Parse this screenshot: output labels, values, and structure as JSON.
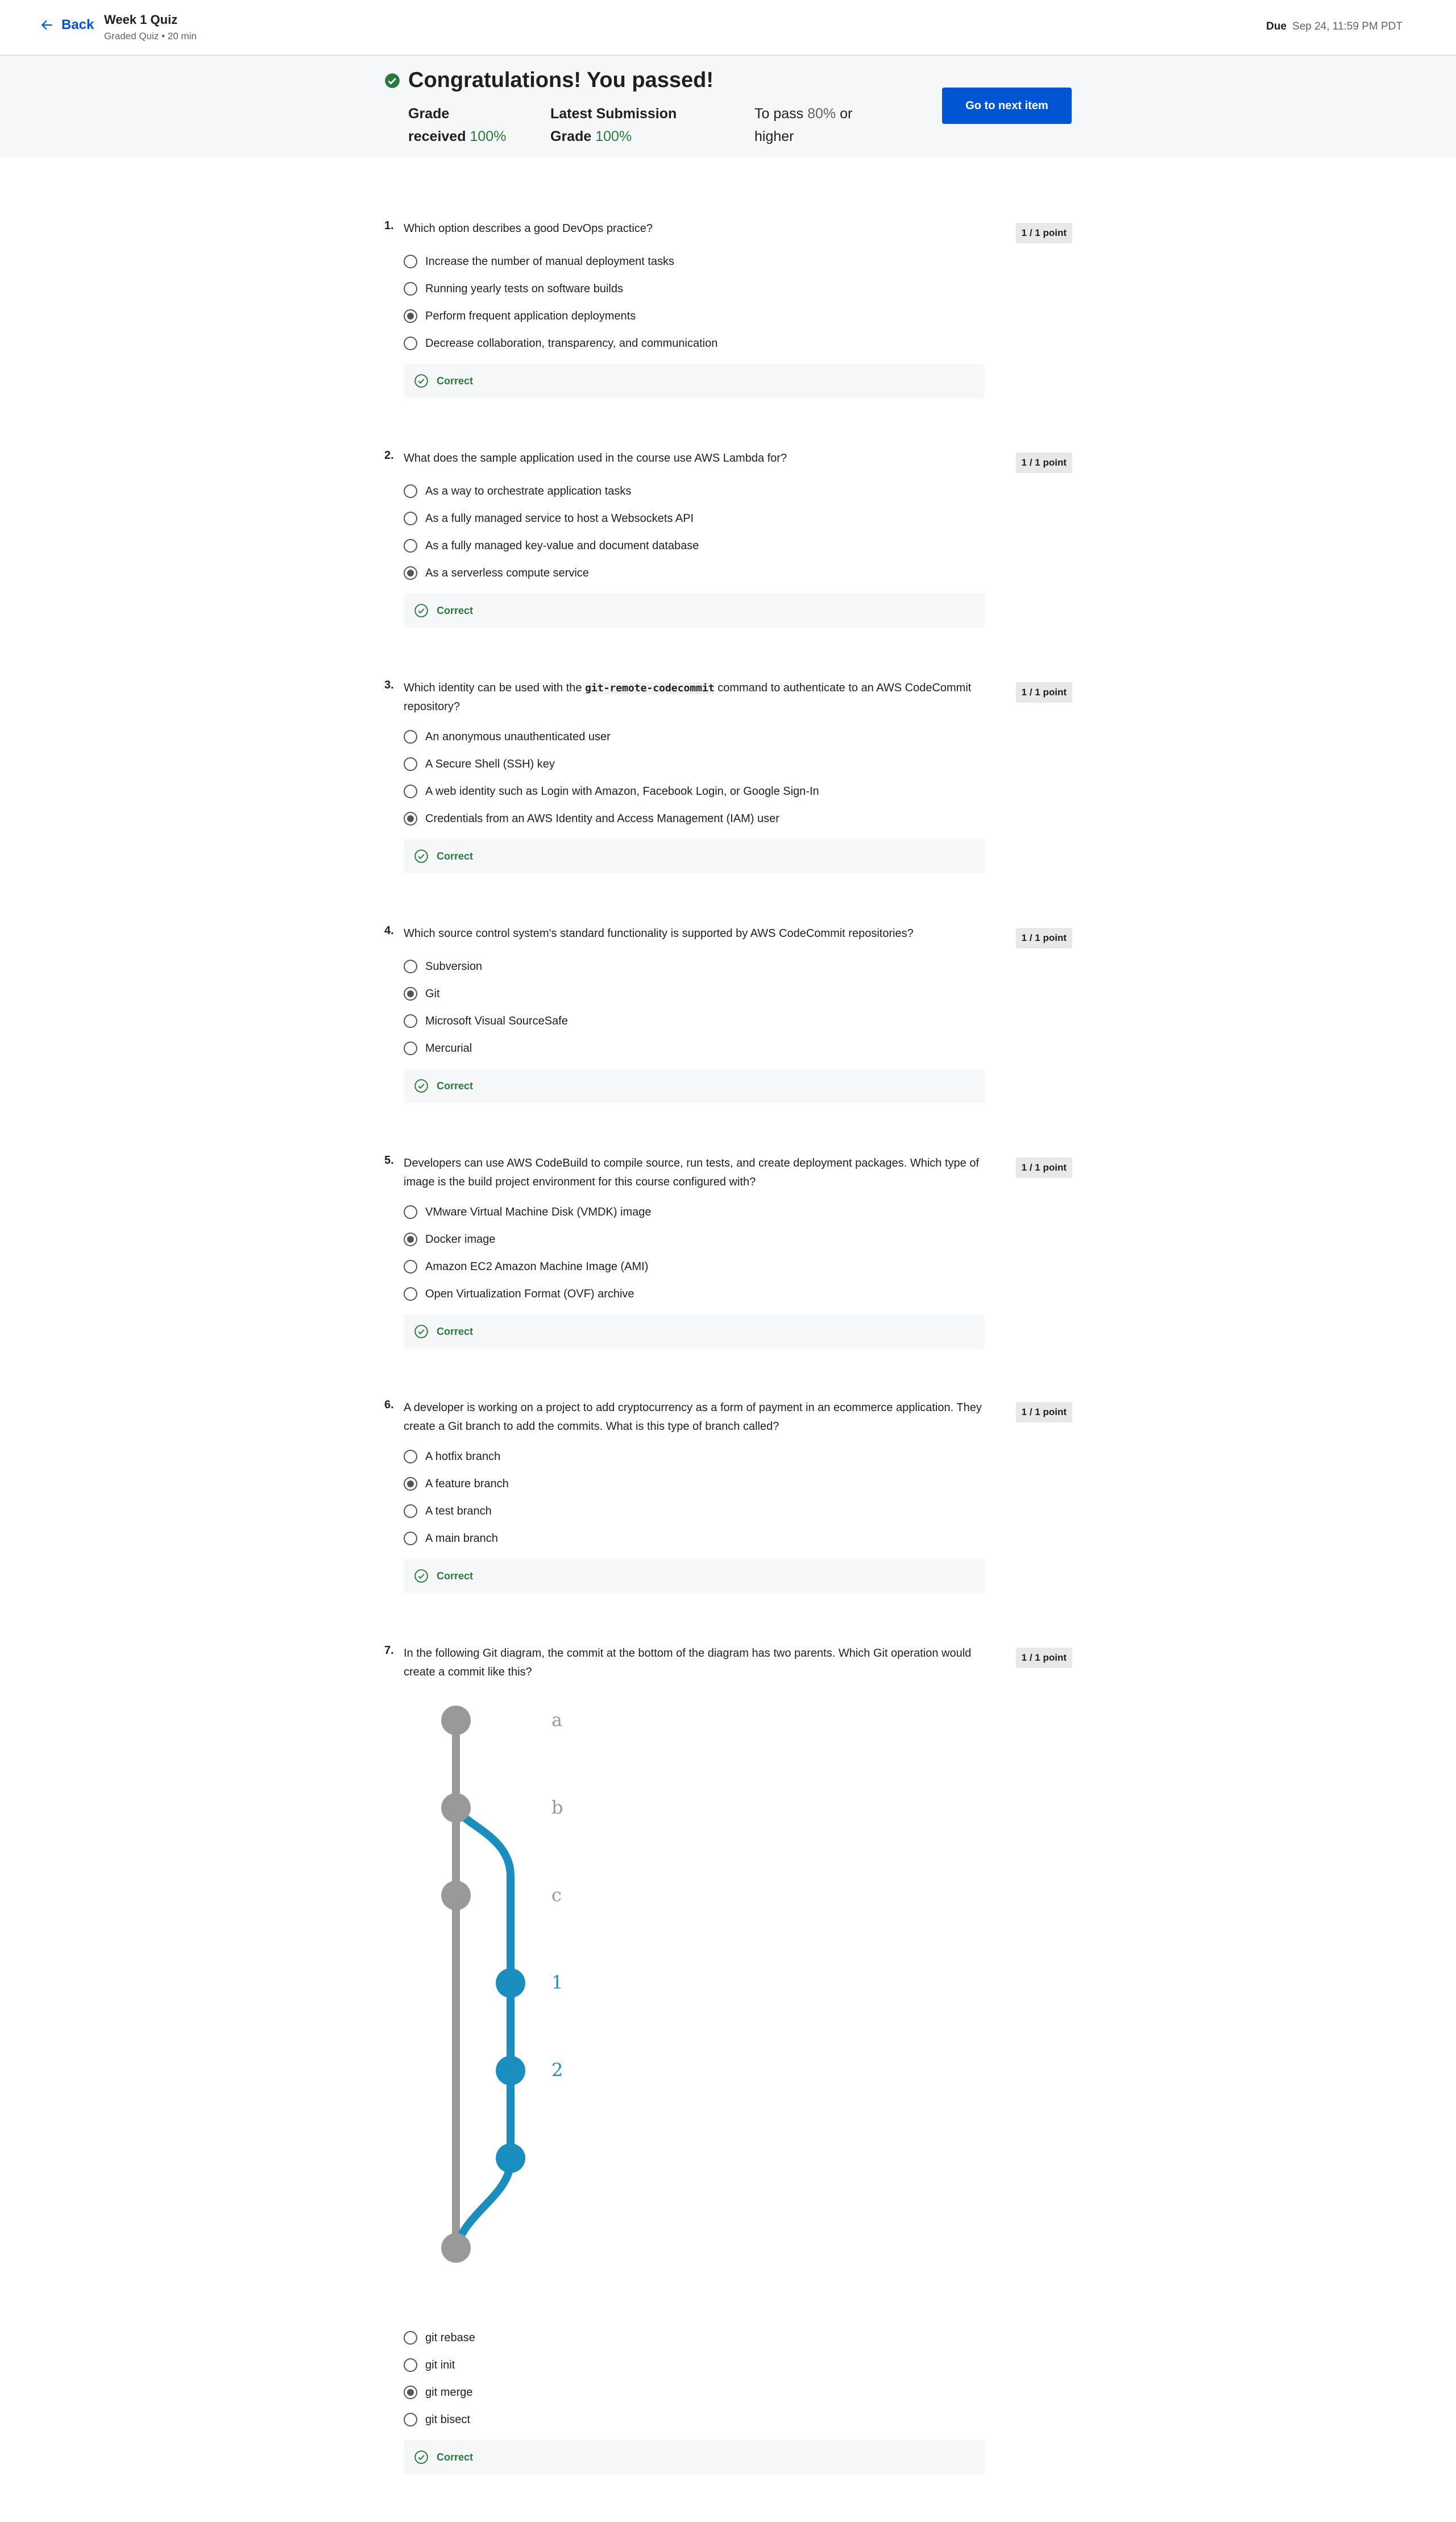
{
  "header": {
    "back_label": "Back",
    "title": "Week 1 Quiz",
    "subtitle": "Graded Quiz • 20 min",
    "due_label": "Due",
    "due_value": "Sep 24, 11:59 PM PDT"
  },
  "result": {
    "title": "Congratulations! You passed!",
    "grade_label_1": "Grade",
    "grade_label_2": "received",
    "grade_value": "100%",
    "latest_label_1": "Latest Submission",
    "latest_label_2": "Grade",
    "latest_value": "100%",
    "topass_label": "To pass",
    "topass_value": "80%",
    "topass_suffix_1": "or",
    "topass_suffix_2": "higher",
    "next_button": "Go to next item",
    "status_color": "#2a7a3b",
    "accent": "#0056d2"
  },
  "questions": [
    {
      "num": "1.",
      "text": "Which option describes a good DevOps practice?",
      "points": "1 / 1 point",
      "options": [
        "Increase the number of manual deployment tasks",
        "Running yearly tests on software builds",
        "Perform frequent application deployments",
        "Decrease collaboration, transparency, and communication"
      ],
      "selected": 2,
      "feedback": "Correct"
    },
    {
      "num": "2.",
      "text": "What does the sample application used in the course use AWS Lambda for?",
      "points": "1 / 1 point",
      "options": [
        "As a way to orchestrate application tasks",
        "As a fully managed service to host a Websockets API",
        "As a fully managed key-value and document database",
        "As a serverless compute service"
      ],
      "selected": 3,
      "feedback": "Correct"
    },
    {
      "num": "3.",
      "text_before": "Which identity can be used with the ",
      "text_code": "git-remote-codecommit",
      "text_after": " command to authenticate to an AWS CodeCommit repository?",
      "points": "1 / 1 point",
      "options": [
        "An anonymous unauthenticated user",
        "A Secure Shell (SSH) key",
        "A web identity such as Login with Amazon, Facebook Login, or Google Sign-In",
        "Credentials from an AWS Identity and Access Management (IAM) user"
      ],
      "selected": 3,
      "feedback": "Correct"
    },
    {
      "num": "4.",
      "text": "Which source control system's standard functionality is supported by AWS CodeCommit repositories?",
      "points": "1 / 1 point",
      "options": [
        "Subversion",
        "Git",
        "Microsoft Visual SourceSafe",
        "Mercurial"
      ],
      "selected": 1,
      "feedback": "Correct"
    },
    {
      "num": "5.",
      "text": "Developers can use AWS CodeBuild to compile source, run tests, and create deployment packages. Which type of image is the build project environment for this course configured with?",
      "points": "1 / 1 point",
      "options": [
        "VMware Virtual Machine Disk (VMDK) image",
        "Docker image",
        "Amazon EC2 Amazon Machine Image (AMI)",
        "Open Virtualization Format (OVF) archive"
      ],
      "selected": 1,
      "feedback": "Correct"
    },
    {
      "num": "6.",
      "text": "A developer is working on a project to add cryptocurrency as a form of payment in an ecommerce application. They create a Git branch to add the commits. What is this type of branch called?",
      "points": "1 / 1 point",
      "options": [
        "A hotfix branch",
        "A feature branch",
        "A test branch",
        "A main branch"
      ],
      "selected": 1,
      "feedback": "Correct"
    },
    {
      "num": "7.",
      "text": "In the following Git diagram, the commit at the bottom of the diagram has two parents. Which Git operation would create a commit like this?",
      "points": "1 / 1 point",
      "options": [
        "git rebase",
        "git init",
        "git merge",
        "git bisect"
      ],
      "selected": 2,
      "feedback": "Correct"
    }
  ],
  "diagram": {
    "labels": [
      "a",
      "b",
      "c",
      "1",
      "2"
    ],
    "main_color": "#999999",
    "branch_color": "#1a8fbf"
  }
}
